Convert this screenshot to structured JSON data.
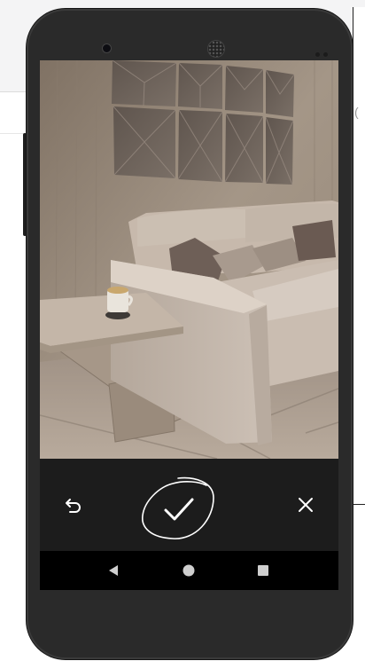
{
  "screen": {
    "photo": {
      "subject": "living-room-sofa-photo"
    },
    "controls": {
      "undo_icon": "undo-icon",
      "confirm_icon": "checkmark-icon",
      "cancel_icon": "close-icon"
    },
    "navbar": {
      "back_icon": "back-triangle-icon",
      "home_icon": "home-circle-icon",
      "recents_icon": "recents-square-icon"
    }
  },
  "colors": {
    "phone_body": "#2a2a2a",
    "controls_bar": "#1c1c1c",
    "icon": "#ffffff"
  }
}
